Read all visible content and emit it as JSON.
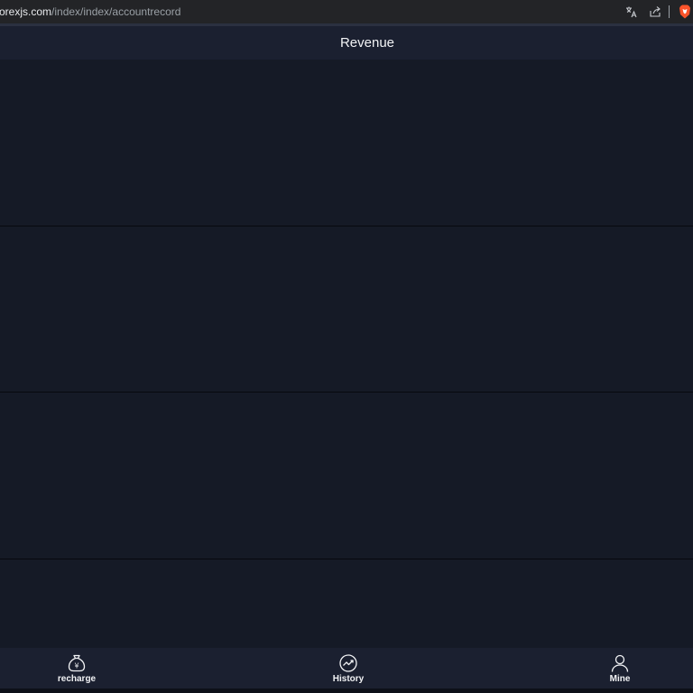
{
  "browser": {
    "url_host": "orexjs.com",
    "url_path": "/index/index/accountrecord"
  },
  "header": {
    "title": "Revenue"
  },
  "tabbar": {
    "items": [
      {
        "label": "recharge",
        "icon": "money-bag-icon"
      },
      {
        "label": "History",
        "icon": "chart-icon"
      },
      {
        "label": "Mine",
        "icon": "user-icon"
      }
    ]
  },
  "colors": {
    "background": "#151a26",
    "header": "#1b2030",
    "text": "#f2f3f5"
  }
}
